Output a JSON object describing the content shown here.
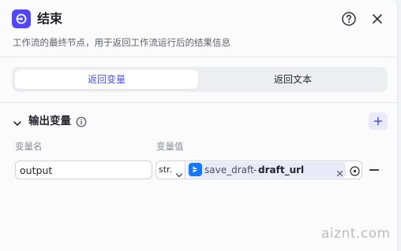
{
  "header": {
    "title": "结束",
    "description": "工作流的最终节点，用于返回工作流运行后的结果信息",
    "node_icon": "end-node-icon",
    "help_icon": "help-icon",
    "close_icon": "close-icon"
  },
  "tabs": [
    {
      "label": "返回变量",
      "active": true
    },
    {
      "label": "返回文本",
      "active": false
    }
  ],
  "output_section": {
    "title": "输出变量",
    "info_icon": "info-icon",
    "add_icon": "plus-icon",
    "col_name": "变量名",
    "col_value": "变量值",
    "rows": [
      {
        "name": "output",
        "type": "str.",
        "ref_node": "save_draft",
        "ref_separator": "-",
        "ref_variable": "draft_url"
      }
    ]
  },
  "colors": {
    "accent": "#4d53e8",
    "node_icon_bg": "#5147ff",
    "ref_icon_bg": "#1677ff",
    "chip_bg": "#e9eaf9"
  },
  "watermark": "aiznt.com"
}
